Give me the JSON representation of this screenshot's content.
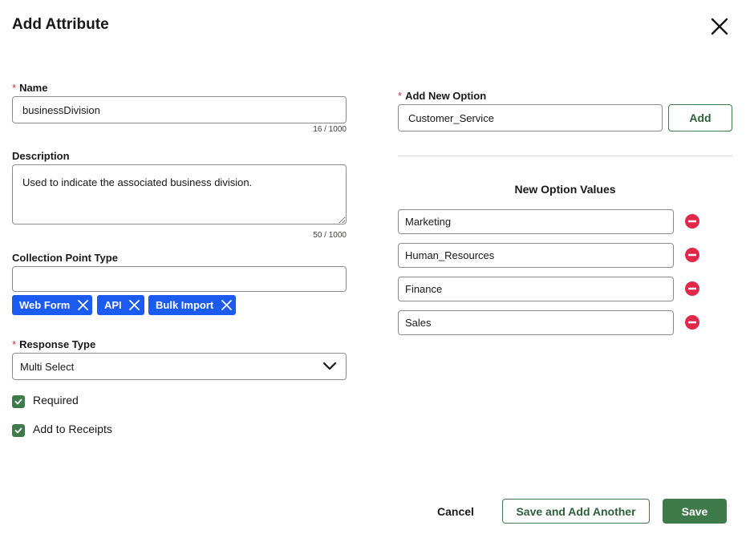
{
  "modal": {
    "title": "Add Attribute"
  },
  "name_field": {
    "label": "Name",
    "value": "businessDivision",
    "counter": "16 / 1000"
  },
  "description_field": {
    "label": "Description",
    "value": "Used to indicate the associated business division.",
    "counter": "50 / 1000"
  },
  "collection_point": {
    "label": "Collection Point Type",
    "value": "",
    "pills": [
      "Web Form",
      "API",
      "Bulk Import"
    ]
  },
  "response_type": {
    "label": "Response Type",
    "selected": "Multi Select"
  },
  "checkboxes": {
    "required_label": "Required",
    "required_checked": true,
    "receipts_label": "Add to Receipts",
    "receipts_checked": true
  },
  "add_option": {
    "label": "Add New Option",
    "value": "Customer_Service",
    "button_label": "Add"
  },
  "option_values": {
    "title": "New Option Values",
    "items": [
      "Marketing",
      "Human_Resources",
      "Finance",
      "Sales"
    ]
  },
  "footer": {
    "cancel_label": "Cancel",
    "save_another_label": "Save and Add Another",
    "save_label": "Save"
  },
  "colors": {
    "pill": "#1b5bef",
    "primary": "#3e7a4a",
    "remove": "#e0294a",
    "required_star": "#c23934"
  },
  "icons": {
    "close": "close-icon",
    "pill_remove": "close-icon",
    "caret": "chevron-down-icon",
    "check": "check-icon",
    "remove_option": "minus-circle-icon"
  }
}
